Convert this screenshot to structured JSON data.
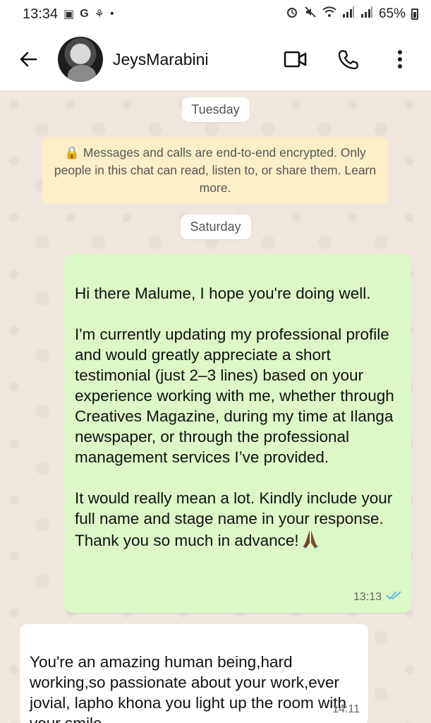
{
  "status_bar": {
    "time": "13:34",
    "left_icons": [
      "gallery-icon",
      "google-icon",
      "app-icon",
      "dot-icon"
    ],
    "left_icon_glyphs": [
      "▣",
      "G",
      "⚘",
      "•"
    ],
    "right_icons": [
      "alarm-icon",
      "mute-icon",
      "wifi-icon",
      "signal-icon",
      "signal-icon"
    ],
    "battery": "65%"
  },
  "header": {
    "contact_name": "JeysMarabini",
    "back_icon": "arrow-left-icon",
    "video_icon": "video-call-icon",
    "call_icon": "phone-icon",
    "menu_icon": "more-vertical-icon"
  },
  "chat": {
    "date_1": "Tuesday",
    "encryption_notice": "🔒 Messages and calls are end-to-end encrypted. Only people in this chat can read, listen to, or share them. Learn more.",
    "date_2": "Saturday",
    "messages": [
      {
        "direction": "outgoing",
        "text": "Hi there Malume, I hope you're doing well.\n\nI'm currently updating my professional profile and would greatly appreciate a short testimonial (just 2–3 lines) based on your experience working with me, whether through Creatives Magazine, during my time at Ilanga newspaper, or through the professional management services I’ve provided.\n\nIt would really mean a lot. Kindly include your full name and stage name in your response. Thank you so much in advance!",
        "emoji": "folded-hands-icon",
        "time": "13:13",
        "status": "read"
      },
      {
        "direction": "incoming",
        "text": "You're an amazing human being,hard working,so passionate about your work,ever jovial, lapho khona you light up the room with your smile",
        "time": "14:11"
      }
    ]
  },
  "colors": {
    "outgoing_bubble": "#dcf8c6",
    "incoming_bubble": "#ffffff",
    "chat_background": "#efe7de",
    "encryption_banner": "#fcefc7",
    "read_ticks": "#4fb6ec"
  }
}
